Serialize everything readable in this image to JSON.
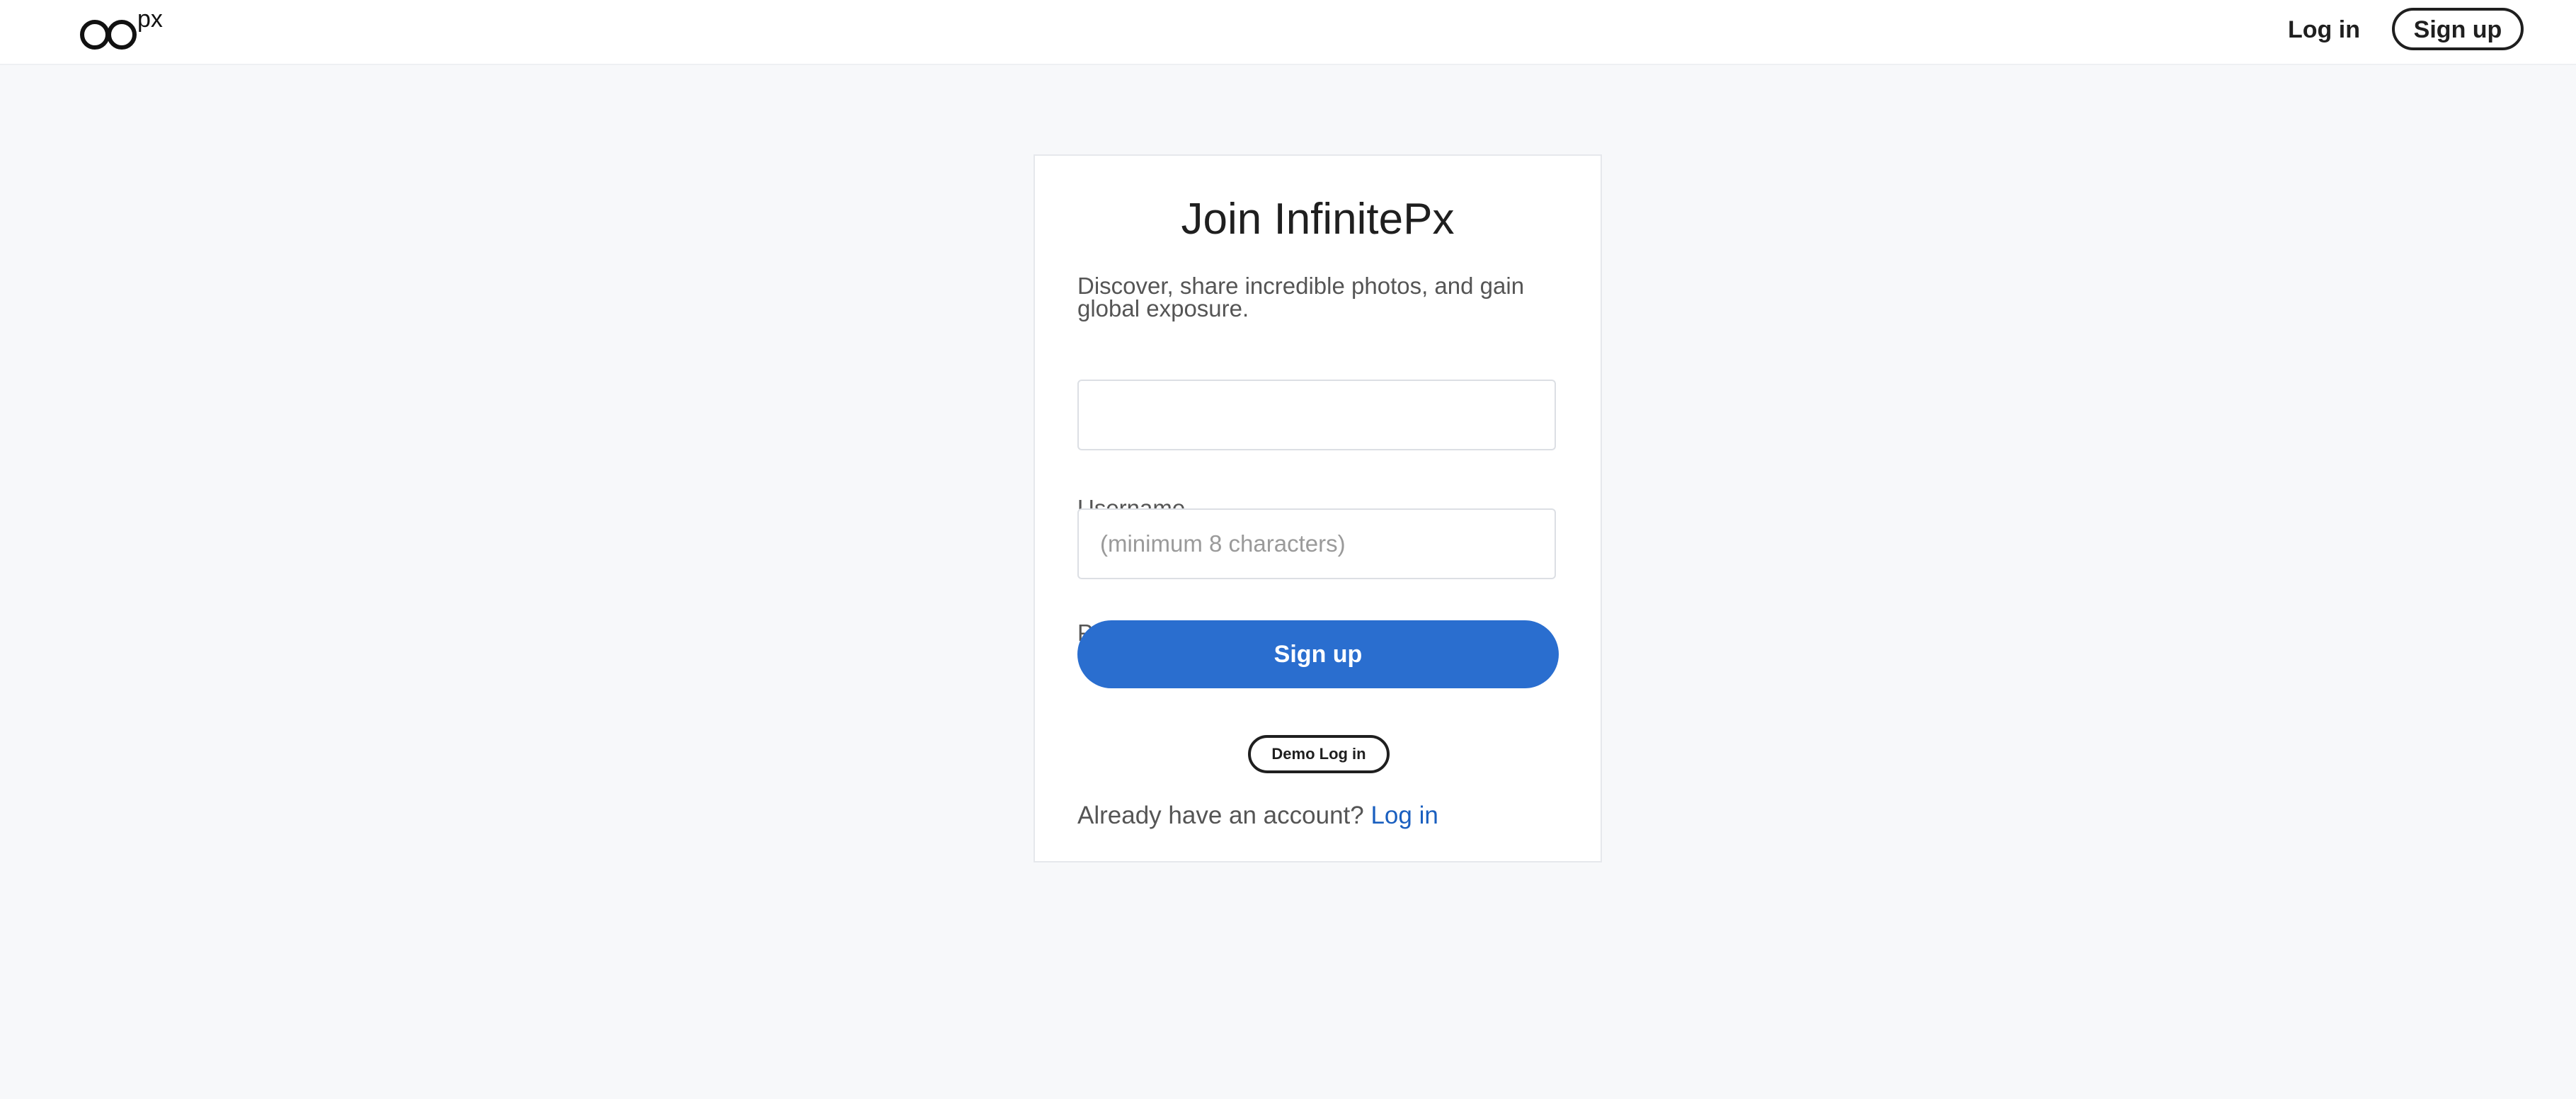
{
  "header": {
    "logo_icon": "infinity-px-logo",
    "logo_text": "px",
    "login_label": "Log in",
    "signup_label": "Sign up"
  },
  "form": {
    "title": "Join InfinitePx",
    "description": "Discover, share incredible photos, and gain global exposure.",
    "username": {
      "label": "Username",
      "value": "",
      "placeholder": ""
    },
    "password": {
      "label": "Password",
      "value": "",
      "placeholder": "(minimum 8 characters)"
    },
    "submit_label": "Sign up",
    "demo_label": "Demo Log in",
    "footer_text": "Already have an account?",
    "footer_link": "Log in"
  },
  "colors": {
    "accent": "#2a6ecf",
    "link": "#1a5fbf",
    "page_background": "#f7f8fa"
  }
}
